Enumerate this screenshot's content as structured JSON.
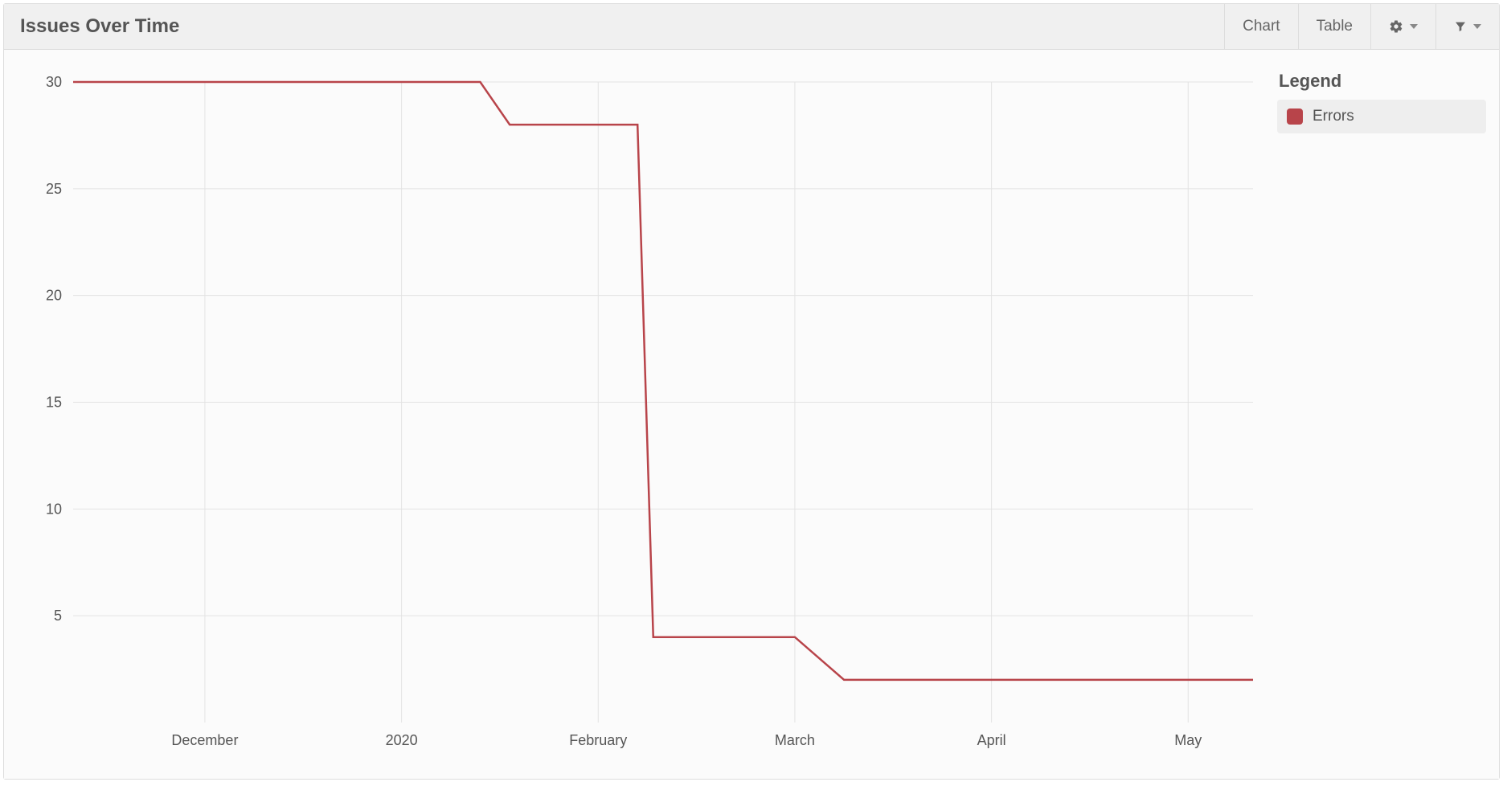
{
  "header": {
    "title": "Issues Over Time",
    "chart_label": "Chart",
    "table_label": "Table"
  },
  "legend": {
    "title": "Legend",
    "items": [
      {
        "label": "Errors",
        "color": "#b8444a"
      }
    ]
  },
  "chart_data": {
    "type": "line",
    "title": "Issues Over Time",
    "xlabel": "",
    "ylabel": "",
    "ylim": [
      0,
      30
    ],
    "y_ticks": [
      5,
      10,
      15,
      20,
      25,
      30
    ],
    "x_ticks": [
      "December",
      "2020",
      "February",
      "March",
      "April",
      "May"
    ],
    "x_tick_positions": [
      1,
      2,
      3,
      4,
      5,
      6
    ],
    "x_domain": [
      0.33,
      6.33
    ],
    "series": [
      {
        "name": "Errors",
        "color": "#b8444a",
        "x": [
          0.33,
          2.4,
          2.55,
          3.2,
          3.28,
          3.55,
          4.0,
          4.25,
          6.33
        ],
        "values": [
          30,
          30,
          28,
          28,
          4,
          4,
          4,
          2,
          2
        ]
      }
    ]
  }
}
